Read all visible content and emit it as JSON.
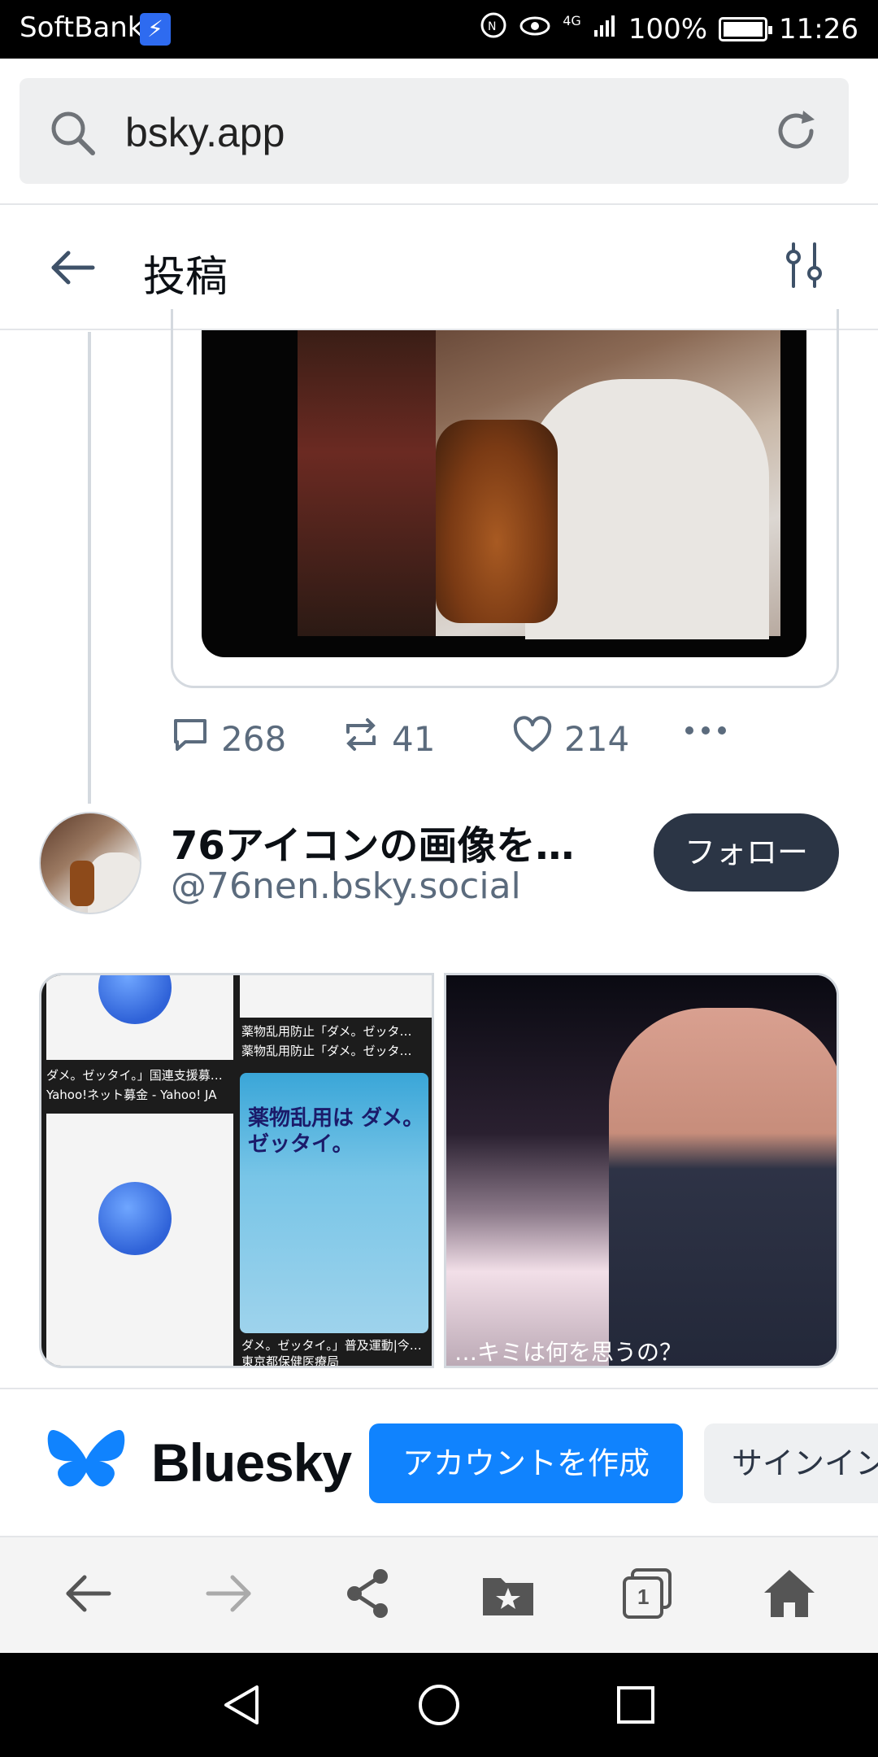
{
  "status_bar": {
    "carrier": "SoftBank",
    "battery": "100%",
    "network": "4G",
    "time": "11:26"
  },
  "browser": {
    "url": "bsky.app"
  },
  "page": {
    "title": "投稿"
  },
  "post_actions": {
    "replies": "268",
    "reposts": "41",
    "likes": "214"
  },
  "next_post": {
    "author_name": "76アイコンの画像を…",
    "author_handle": "@76nen.bsky.social",
    "follow_label": "フォロー",
    "gallery": {
      "left_snippets": [
        "ダメ。ゼッタイ。」国連支援募…",
        "Yahoo!ネット募金 - Yahoo! JA",
        "薬物乱用防止「ダメ。ゼッタ…",
        "薬物乱用防止「ダメ。ゼッタ…",
        "ダメ。ゼッタイ。」普及運動|今…",
        "東京都保健医療局"
      ],
      "poster_text": "薬物乱用は ダメ。ゼッタイ。",
      "right_caption": "…キミは何を思うの？"
    }
  },
  "banner": {
    "brand": "Bluesky",
    "create_account": "アカウントを作成",
    "sign_in": "サインイン"
  },
  "browser_nav": {
    "tab_count": "1"
  },
  "colors": {
    "accent": "#1083fe",
    "follow_bg": "#2b3545",
    "muted_text": "#5b6b7d"
  }
}
